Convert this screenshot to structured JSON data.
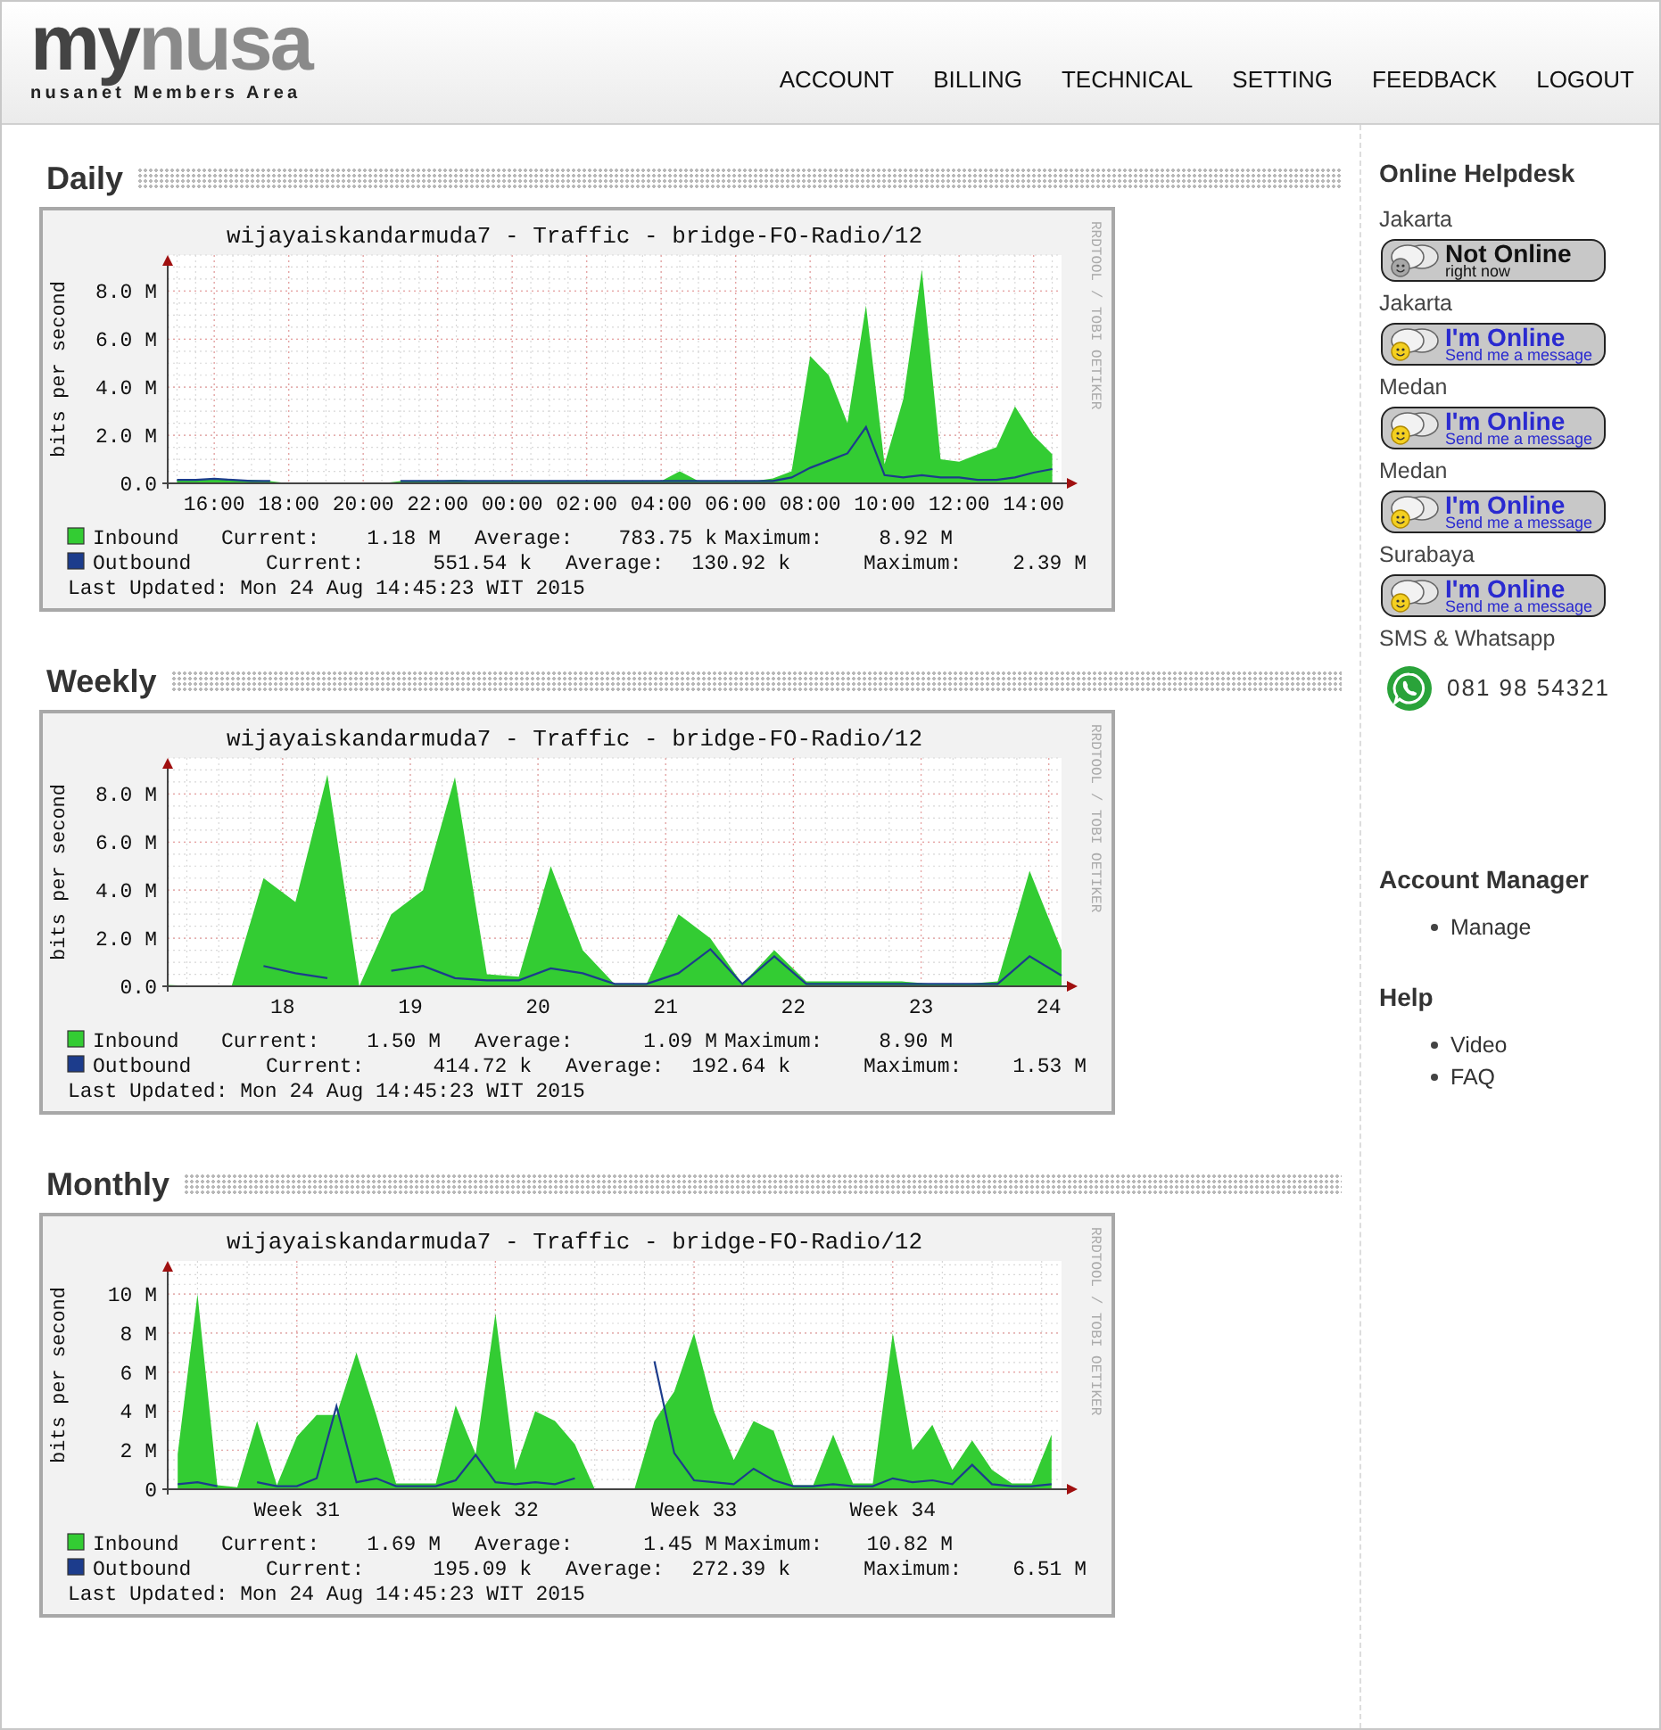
{
  "header": {
    "logo": {
      "dark": "my",
      "light": "nusa",
      "tagline": "nusanet Members Area"
    },
    "nav": [
      "ACCOUNT",
      "BILLING",
      "TECHNICAL",
      "SETTING",
      "FEEDBACK",
      "LOGOUT"
    ]
  },
  "sections": [
    {
      "heading": "Daily",
      "graph": {
        "title": "wijayaiskandarmuda7 - Traffic - bridge-FO-Radio/12",
        "credit": "RRDTOOL / TOBI OETIKER",
        "chart_data": {
          "type": "area",
          "ylabel": "bits per second",
          "grid": true,
          "legend": "bottom",
          "categories": [
            null,
            null,
            "16:00",
            null,
            null,
            null,
            "18:00",
            null,
            null,
            null,
            "20:00",
            null,
            null,
            null,
            "22:00",
            null,
            null,
            null,
            "00:00",
            null,
            null,
            null,
            "02:00",
            null,
            null,
            null,
            "04:00",
            null,
            null,
            null,
            "06:00",
            null,
            null,
            null,
            "08:00",
            null,
            null,
            null,
            "10:00",
            null,
            null,
            null,
            "12:00",
            null,
            null,
            null,
            "14:00",
            null
          ],
          "series": [
            {
              "name": "Inbound",
              "type": "area",
              "color": "#33cc33",
              "values": [
                0.15,
                0.15,
                0.2,
                0.15,
                0.15,
                0.1,
                0,
                0,
                0,
                0,
                0,
                0,
                0.1,
                0.1,
                0.1,
                0.15,
                0.1,
                0.1,
                0.1,
                0.1,
                0.1,
                0.1,
                0.1,
                0.1,
                0.1,
                0.1,
                0.1,
                0.5,
                0.1,
                0.1,
                0.1,
                0.1,
                0.2,
                0.5,
                5.3,
                4.5,
                2.5,
                7.4,
                0.8,
                3.5,
                8.9,
                1.0,
                0.9,
                1.2,
                1.5,
                3.2,
                2.0,
                1.2
              ]
            },
            {
              "name": "Outbound",
              "type": "line",
              "color": "#1c3c8c",
              "values": [
                0.1,
                0.1,
                0.15,
                0.1,
                0.05,
                0.05,
                null,
                null,
                null,
                null,
                null,
                null,
                0.05,
                0.05,
                0.05,
                0.05,
                0.05,
                0.05,
                0.05,
                0.05,
                0.05,
                0.05,
                0.05,
                0.05,
                0.05,
                0.05,
                0.05,
                0.05,
                0.05,
                0.05,
                0.05,
                0.05,
                0.05,
                0.2,
                0.6,
                0.9,
                1.2,
                2.3,
                0.3,
                0.2,
                0.3,
                0.2,
                0.2,
                0.1,
                0.1,
                0.2,
                0.4,
                0.55
              ]
            }
          ],
          "ylim": [
            0,
            9.5
          ],
          "yticks": [
            {
              "value": 0,
              "label": "0.0"
            },
            {
              "value": 2,
              "label": "2.0 M"
            },
            {
              "value": 4,
              "label": "4.0 M"
            },
            {
              "value": 6,
              "label": "6.0 M"
            },
            {
              "value": 8,
              "label": "8.0 M"
            }
          ]
        },
        "legend": [
          {
            "stats": [
              {
                "label": "Current:",
                "value": "1.18 M"
              },
              {
                "label": "Average:",
                "value": "783.75 k"
              },
              {
                "label": "Maximum:",
                "value": "8.92 M"
              }
            ]
          },
          {
            "stats": [
              {
                "label": "Current:",
                "value": "551.54 k"
              },
              {
                "label": "Average:",
                "value": "130.92 k"
              },
              {
                "label": "Maximum:",
                "value": "2.39 M"
              }
            ]
          }
        ],
        "last_updated": "Last Updated: Mon 24 Aug 14:45:23 WIT 2015"
      }
    },
    {
      "heading": "Weekly",
      "graph": {
        "title": "wijayaiskandarmuda7 - Traffic - bridge-FO-Radio/12",
        "credit": "RRDTOOL / TOBI OETIKER",
        "chart_data": {
          "type": "area",
          "ylabel": "bits per second",
          "grid": true,
          "legend": "bottom",
          "x": [
            17.1,
            17.35,
            17.6,
            17.85,
            18.1,
            18.35,
            18.6,
            18.85,
            19.1,
            19.35,
            19.6,
            19.85,
            20.1,
            20.35,
            20.6,
            20.85,
            21.1,
            21.35,
            21.6,
            21.85,
            22.1,
            22.35,
            22.6,
            22.85,
            23.1,
            23.35,
            23.6,
            23.85,
            24.1
          ],
          "series": [
            {
              "name": "Inbound",
              "type": "area",
              "color": "#33cc33",
              "values": [
                0.05,
                0,
                0,
                4.5,
                3.5,
                8.8,
                0,
                3.0,
                4.0,
                8.7,
                0.5,
                0.4,
                5.0,
                1.5,
                0.1,
                0.1,
                3.0,
                2.0,
                0.1,
                1.5,
                0.2,
                0.2,
                0.2,
                0.2,
                0.1,
                0.1,
                0.2,
                4.8,
                1.5
              ]
            },
            {
              "name": "Outbound",
              "type": "line",
              "color": "#1c3c8c",
              "values": [
                null,
                null,
                null,
                0.8,
                0.5,
                0.3,
                null,
                0.6,
                0.8,
                0.3,
                0.2,
                0.2,
                0.7,
                0.5,
                0.05,
                0.05,
                0.5,
                1.5,
                0.05,
                1.2,
                0.05,
                0.05,
                0.05,
                0.05,
                0.05,
                0.05,
                0.05,
                1.2,
                0.4
              ]
            }
          ],
          "xlim": [
            17.1,
            24.1
          ],
          "ylim": [
            0,
            9.5
          ],
          "xticks": [
            {
              "value": 18,
              "label": "18"
            },
            {
              "value": 19,
              "label": "19"
            },
            {
              "value": 20,
              "label": "20"
            },
            {
              "value": 21,
              "label": "21"
            },
            {
              "value": 22,
              "label": "22"
            },
            {
              "value": 23,
              "label": "23"
            },
            {
              "value": 24,
              "label": "24"
            }
          ],
          "yticks": [
            {
              "value": 0,
              "label": "0.0"
            },
            {
              "value": 2,
              "label": "2.0 M"
            },
            {
              "value": 4,
              "label": "4.0 M"
            },
            {
              "value": 6,
              "label": "6.0 M"
            },
            {
              "value": 8,
              "label": "8.0 M"
            }
          ]
        },
        "legend": [
          {
            "stats": [
              {
                "label": "Current:",
                "value": "1.50 M"
              },
              {
                "label": "Average:",
                "value": "1.09 M"
              },
              {
                "label": "Maximum:",
                "value": "8.90 M"
              }
            ]
          },
          {
            "stats": [
              {
                "label": "Current:",
                "value": "414.72 k"
              },
              {
                "label": "Average:",
                "value": "192.64 k"
              },
              {
                "label": "Maximum:",
                "value": "1.53 M"
              }
            ]
          }
        ],
        "last_updated": "Last Updated: Mon 24 Aug 14:45:23 WIT 2015"
      }
    },
    {
      "heading": "Monthly",
      "graph": {
        "title": "wijayaiskandarmuda7 - Traffic - bridge-FO-Radio/12",
        "credit": "RRDTOOL / TOBI OETIKER",
        "chart_data": {
          "type": "area",
          "ylabel": "bits per second",
          "grid": true,
          "legend": "bottom",
          "categories": [
            null,
            null,
            null,
            null,
            null,
            null,
            "Week 31",
            null,
            null,
            null,
            null,
            null,
            null,
            null,
            null,
            null,
            "Week 32",
            null,
            null,
            null,
            null,
            null,
            null,
            null,
            null,
            null,
            "Week 33",
            null,
            null,
            null,
            null,
            null,
            null,
            null,
            null,
            null,
            "Week 34",
            null,
            null,
            null,
            null,
            null,
            null,
            null,
            null
          ],
          "series": [
            {
              "name": "Inbound",
              "type": "area",
              "color": "#33cc33",
              "values": [
                1.8,
                10,
                0.2,
                0.1,
                3.5,
                0.2,
                2.7,
                3.8,
                3.8,
                7.0,
                3.8,
                0.3,
                0.3,
                0.3,
                4.3,
                1.8,
                9.0,
                1.0,
                4.0,
                3.5,
                2.3,
                0,
                0,
                0,
                3.5,
                5.0,
                8.0,
                4.0,
                1.5,
                3.5,
                3.0,
                0.2,
                0.2,
                2.8,
                0.3,
                0.3,
                8.0,
                2.0,
                3.3,
                1.0,
                2.5,
                1.0,
                0.3,
                0.3,
                2.8
              ]
            },
            {
              "name": "Outbound",
              "type": "line",
              "color": "#1c3c8c",
              "values": [
                0.2,
                0.3,
                0.1,
                null,
                0.3,
                0.1,
                0.1,
                0.5,
                4.2,
                0.3,
                0.5,
                0.1,
                0.1,
                0.1,
                0.4,
                1.7,
                0.3,
                0.2,
                0.3,
                0.2,
                0.5,
                null,
                null,
                null,
                6.5,
                1.8,
                0.4,
                0.3,
                0.2,
                1.0,
                0.4,
                0.1,
                0.1,
                0.2,
                0.1,
                0.1,
                0.5,
                0.3,
                0.4,
                0.2,
                1.2,
                0.2,
                0.1,
                0.1,
                0.2
              ]
            }
          ],
          "ylim": [
            0,
            11.7
          ],
          "yticks": [
            {
              "value": 0,
              "label": "0"
            },
            {
              "value": 2,
              "label": "2 M"
            },
            {
              "value": 4,
              "label": "4 M"
            },
            {
              "value": 6,
              "label": "6 M"
            },
            {
              "value": 8,
              "label": "8 M"
            },
            {
              "value": 10,
              "label": "10 M"
            }
          ]
        },
        "legend": [
          {
            "stats": [
              {
                "label": "Current:",
                "value": "1.69 M"
              },
              {
                "label": "Average:",
                "value": "1.45 M"
              },
              {
                "label": "Maximum:",
                "value": "10.82 M"
              }
            ]
          },
          {
            "stats": [
              {
                "label": "Current:",
                "value": "195.09 k"
              },
              {
                "label": "Average:",
                "value": "272.39 k"
              },
              {
                "label": "Maximum:",
                "value": "6.51 M"
              }
            ]
          }
        ],
        "last_updated": "Last Updated: Mon 24 Aug 14:45:23 WIT 2015"
      }
    }
  ],
  "sidebar": {
    "helpdesk": {
      "title": "Online Helpdesk",
      "agents": [
        {
          "location": "Jakarta",
          "online": false,
          "status_title": "Not Online",
          "status_subtitle": "right now"
        },
        {
          "location": "Jakarta",
          "online": true,
          "status_title": "I'm Online",
          "status_subtitle": "Send me a message"
        },
        {
          "location": "Medan",
          "online": true,
          "status_title": "I'm Online",
          "status_subtitle": "Send me a message"
        },
        {
          "location": "Medan",
          "online": true,
          "status_title": "I'm Online",
          "status_subtitle": "Send me a message"
        },
        {
          "location": "Surabaya",
          "online": true,
          "status_title": "I'm Online",
          "status_subtitle": "Send me a message"
        }
      ],
      "contact_label": "SMS & Whatsapp",
      "phone": "081 98 54321"
    },
    "account_manager": {
      "title": "Account Manager",
      "links": [
        "Manage"
      ]
    },
    "help": {
      "title": "Help",
      "links": [
        "Video",
        "FAQ"
      ]
    }
  }
}
